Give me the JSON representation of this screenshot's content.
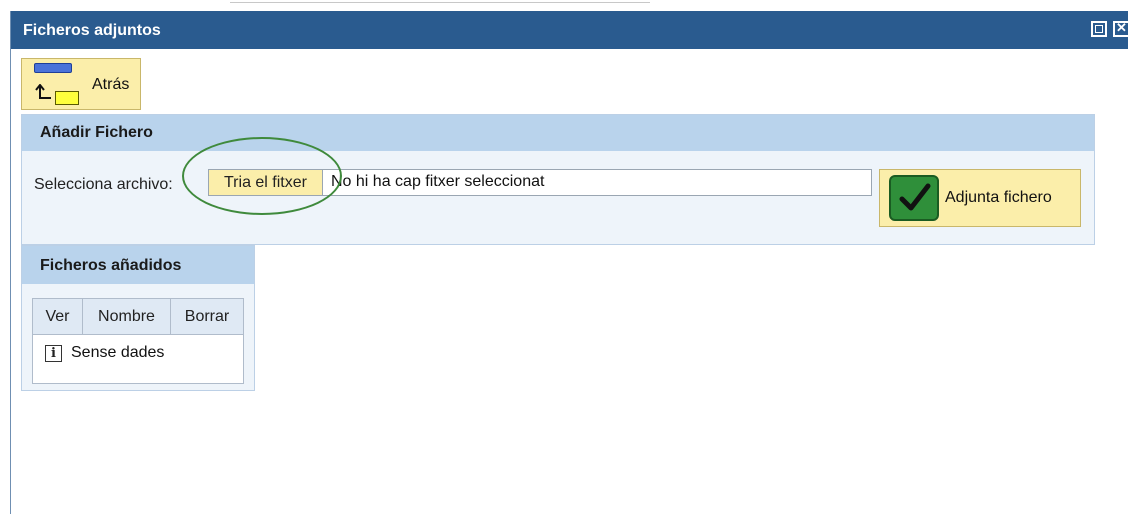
{
  "window": {
    "title": "Ficheros adjuntos"
  },
  "toolbar": {
    "back_label": "Atrás"
  },
  "add_file": {
    "header": "Añadir Fichero",
    "select_label": "Selecciona archivo:",
    "choose_button": "Tria el fitxer",
    "no_file_text": "No hi ha cap fitxer seleccionat",
    "attach_button": "Adjunta fichero"
  },
  "files": {
    "header": "Ficheros añadidos",
    "columns": [
      "Ver",
      "Nombre",
      "Borrar"
    ],
    "empty_text": "Sense dades"
  },
  "colors": {
    "titlebar": "#2a5b8f",
    "button_bg": "#fbeeaa",
    "panel_header": "#b9d3ec",
    "highlight": "#3f8a3c"
  }
}
